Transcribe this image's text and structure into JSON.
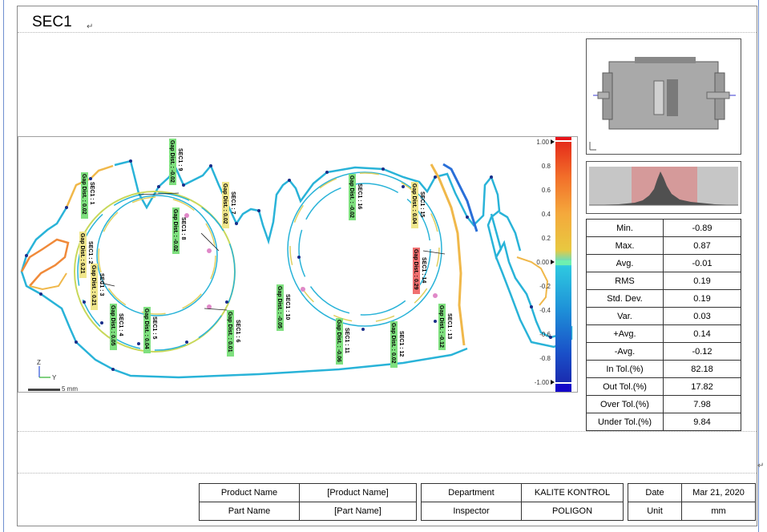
{
  "report": {
    "title": "SEC1"
  },
  "color_scale": {
    "ticks": [
      "1.00",
      "0.8",
      "0.6",
      "0.4",
      "0.2",
      "0.00",
      "-0.2",
      "-0.4",
      "-0.6",
      "-0.8",
      "-1.00"
    ]
  },
  "axis_triad": {
    "y_label": "Y",
    "z_label": "Z"
  },
  "scale_bar": {
    "label": "5 mm"
  },
  "gap_labels": [
    {
      "name": "SEC1 : 1",
      "value": "Gap Dist. : 0.02",
      "color": "#7fe07f"
    },
    {
      "name": "SEC1 : 2",
      "value": "Gap Dist. : 0.21",
      "color": "#f0e68c"
    },
    {
      "name": "SEC1 : 3",
      "value": "Gap Dist. : 0.21",
      "color": "#f0e68c"
    },
    {
      "name": "SEC1 : 4",
      "value": "Gap Dist. : 0.05",
      "color": "#7fe07f"
    },
    {
      "name": "SEC1 : 5",
      "value": "Gap Dist. : 0.04",
      "color": "#7fe07f"
    },
    {
      "name": "SEC1 : 6",
      "value": "Gap Dist. : 0.01",
      "color": "#7fe07f"
    },
    {
      "name": "SEC1 : 7",
      "value": "Gap Dist. : 0.02",
      "color": "#f0e68c"
    },
    {
      "name": "SEC1 : 8",
      "value": "Gap Dist. : -0.02",
      "color": "#7fe07f"
    },
    {
      "name": "SEC1 : 9",
      "value": "Gap Dist. : -0.02",
      "color": "#7fe07f"
    },
    {
      "name": "SEC1 : 10",
      "value": "Gap Dist. : -0.05",
      "color": "#7fe07f"
    },
    {
      "name": "SEC1 : 11",
      "value": "Gap Dist. : -0.06",
      "color": "#7fe07f"
    },
    {
      "name": "SEC1 : 12",
      "value": "Gap Dist. : 0.02",
      "color": "#7fe07f"
    },
    {
      "name": "SEC1 : 13",
      "value": "Gap Dist. : -0.12",
      "color": "#7fe07f"
    },
    {
      "name": "SEC1 : 14",
      "value": "Gap Dist. : 0.29",
      "color": "#f07070"
    },
    {
      "name": "SEC1 : 15",
      "value": "Gap Dist. : 0.04",
      "color": "#f0e68c"
    },
    {
      "name": "SEC1 : 16",
      "value": "Gap Dist. : -0.02",
      "color": "#7fe07f"
    }
  ],
  "stats": [
    {
      "label": "Min.",
      "value": "-0.89"
    },
    {
      "label": "Max.",
      "value": "0.87"
    },
    {
      "label": "Avg.",
      "value": "-0.01"
    },
    {
      "label": "RMS",
      "value": "0.19"
    },
    {
      "label": "Std. Dev.",
      "value": "0.19"
    },
    {
      "label": "Var.",
      "value": "0.03"
    },
    {
      "label": "+Avg.",
      "value": "0.14"
    },
    {
      "label": "-Avg.",
      "value": "-0.12"
    },
    {
      "label": "In Tol.(%)",
      "value": "82.18"
    },
    {
      "label": "Out Tol.(%)",
      "value": "17.82"
    },
    {
      "label": "Over Tol.(%)",
      "value": "7.98"
    },
    {
      "label": "Under Tol.(%)",
      "value": "9.84"
    }
  ],
  "footer": {
    "product_name_label": "Product Name",
    "product_name_value": "[Product Name]",
    "part_name_label": "Part Name",
    "part_name_value": "[Part Name]",
    "department_label": "Department",
    "department_value": "KALITE KONTROL",
    "inspector_label": "Inspector",
    "inspector_value": "POLIGON",
    "date_label": "Date",
    "date_value": "Mar 21, 2020",
    "unit_label": "Unit",
    "unit_value": "mm"
  }
}
